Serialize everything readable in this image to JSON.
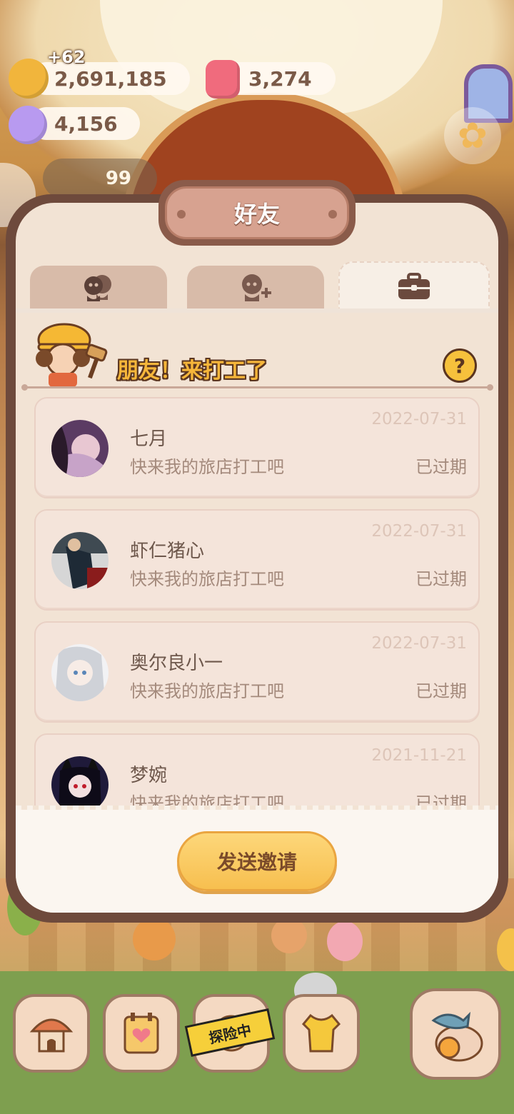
{
  "resources": {
    "gold_plus": "+62",
    "gold": "2,691,185",
    "gems": "3,274",
    "candy": "4,156",
    "level": "99"
  },
  "dialog": {
    "title": "好友",
    "tabs": [
      {
        "icon": "friends-icon",
        "active": false
      },
      {
        "icon": "add-friend-icon",
        "active": false
      },
      {
        "icon": "briefcase-icon",
        "active": true
      }
    ],
    "banner_title": "朋友！来打工了",
    "help_label": "?",
    "invites": [
      {
        "name": "七月",
        "message": "快来我的旅店打工吧",
        "date": "2022-07-31",
        "status": "已过期",
        "avatar_color": "#5b3b63"
      },
      {
        "name": "虾仁猪心",
        "message": "快来我的旅店打工吧",
        "date": "2022-07-31",
        "status": "已过期",
        "avatar_color": "#3f4a52"
      },
      {
        "name": "奥尔良小一",
        "message": "快来我的旅店打工吧",
        "date": "2022-07-31",
        "status": "已过期",
        "avatar_color": "#d8d8dc"
      },
      {
        "name": "梦婉",
        "message": "快来我的旅店打工吧",
        "date": "2021-11-21",
        "status": "已过期",
        "avatar_color": "#1f1a3a"
      }
    ],
    "send_button": "发送邀请"
  },
  "bottom_nav": {
    "explore_tag": "探险中",
    "items": [
      "house-icon",
      "notebook-icon",
      "explore-icon",
      "shirt-icon",
      "fish-bag-icon"
    ]
  },
  "colors": {
    "dialog_border": "#6e4a3c",
    "dialog_bg": "#f2e3d4",
    "accent_yellow": "#f7bf4f",
    "text_brown": "#6e584c"
  }
}
